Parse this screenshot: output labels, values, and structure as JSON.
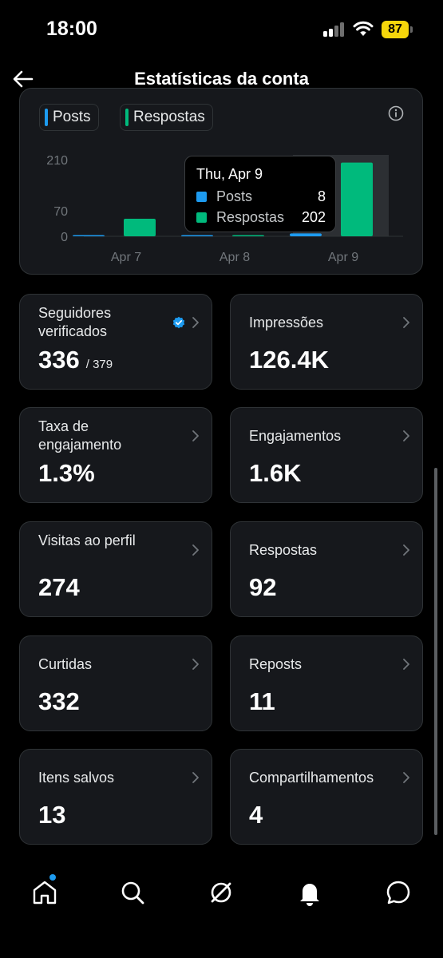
{
  "status_bar": {
    "time": "18:00",
    "battery": "87"
  },
  "header": {
    "title": "Estatísticas da conta"
  },
  "legend": [
    {
      "label": "Posts",
      "color": "#1d9bf0"
    },
    {
      "label": "Respostas",
      "color": "#00ba7c"
    }
  ],
  "tooltip": {
    "title": "Thu, Apr 9",
    "rows": [
      {
        "label": "Posts",
        "value": "8",
        "color": "#1d9bf0"
      },
      {
        "label": "Respostas",
        "value": "202",
        "color": "#00ba7c"
      }
    ]
  },
  "chart_data": {
    "type": "bar",
    "categories": [
      "Apr 7",
      "Apr 8",
      "Apr 9"
    ],
    "series": [
      {
        "name": "Posts",
        "values": [
          1,
          1,
          8
        ],
        "color": "#1d9bf0"
      },
      {
        "name": "Respostas",
        "values": [
          48,
          3,
          202
        ],
        "color": "#00ba7c"
      }
    ],
    "yticks": [
      "210",
      "70",
      "0"
    ],
    "ytick_values": [
      210,
      70,
      0
    ],
    "ylim": [
      0,
      210
    ],
    "highlighted_category": "Apr 9",
    "title": "",
    "xlabel": "",
    "ylabel": ""
  },
  "stats": [
    {
      "label": "Seguidores verificados",
      "value": "336",
      "sub": "/ 379",
      "verified": true
    },
    {
      "label": "Impressões",
      "value": "126.4K"
    },
    {
      "label": "Taxa de engajamento",
      "value": "1.3%"
    },
    {
      "label": "Engajamentos",
      "value": "1.6K"
    },
    {
      "label": "Visitas ao perfil",
      "value": "274"
    },
    {
      "label": "Respostas",
      "value": "92"
    },
    {
      "label": "Curtidas",
      "value": "332"
    },
    {
      "label": "Reposts",
      "value": "11"
    },
    {
      "label": "Itens salvos",
      "value": "13"
    },
    {
      "label": "Compartilhamentos",
      "value": "4"
    }
  ],
  "nav": [
    "home-icon",
    "search-icon",
    "grok-icon",
    "notifications-icon",
    "messages-icon"
  ],
  "colors": {
    "accent": "#1d9bf0",
    "green": "#00ba7c",
    "card": "#16181c",
    "border": "#2f3336"
  }
}
